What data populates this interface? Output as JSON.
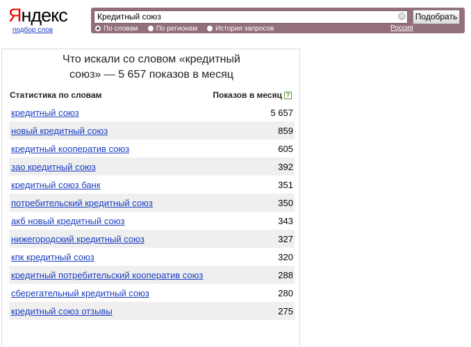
{
  "header": {
    "logo_first": "Я",
    "logo_rest": "ндекс",
    "logo_sub": "подбор слов",
    "search_value": "Кредитный союз",
    "search_button": "Подобрать",
    "radios": [
      {
        "label": "По словам",
        "checked": true
      },
      {
        "label": "По регионам",
        "checked": false
      },
      {
        "label": "История запросов",
        "checked": false
      }
    ],
    "region": "Россия"
  },
  "main": {
    "title_line1": "Что искали со словом «кредитный",
    "title_line2": "союз» — 5 657 показов в месяц",
    "col_left": "Статистика по словам",
    "col_right": "Показов в месяц",
    "help_icon": "?",
    "rows": [
      {
        "phrase": "кредитный союз",
        "count": "5 657"
      },
      {
        "phrase": "новый кредитный союз",
        "count": "859"
      },
      {
        "phrase": "кредитный кооператив союз",
        "count": "605"
      },
      {
        "phrase": "зао кредитный союз",
        "count": "392"
      },
      {
        "phrase": "кредитный союз банк",
        "count": "351"
      },
      {
        "phrase": "потребительский кредитный союз",
        "count": "350"
      },
      {
        "phrase": "акб новый кредитный союз",
        "count": "343"
      },
      {
        "phrase": "нижегородский кредитный союз",
        "count": "327"
      },
      {
        "phrase": "кпк кредитный союз",
        "count": "320"
      },
      {
        "phrase": "кредитный потребительский кооператив союз",
        "count": "288"
      },
      {
        "phrase": "сберегательный кредитный союз",
        "count": "280"
      },
      {
        "phrase": "кредитный союз отзывы",
        "count": "275"
      }
    ]
  }
}
